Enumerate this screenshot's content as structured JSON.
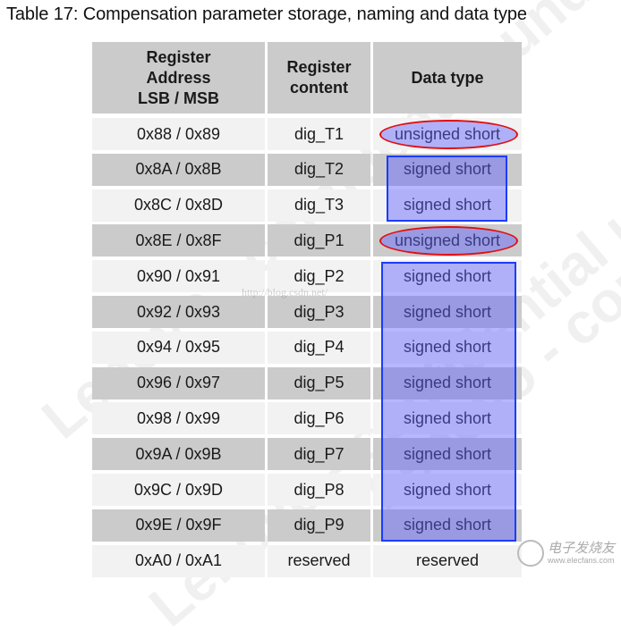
{
  "caption": "Table 17: Compensation parameter storage, naming and data type",
  "table": {
    "headers": [
      "Register\nAddress\nLSB / MSB",
      "Register\ncontent",
      "Data type"
    ],
    "rows": [
      {
        "address": "0x88 / 0x89",
        "content": "dig_T1",
        "type": "unsigned short",
        "highlight": "ellipse"
      },
      {
        "address": "0x8A / 0x8B",
        "content": "dig_T2",
        "type": "signed short",
        "highlight": "box"
      },
      {
        "address": "0x8C / 0x8D",
        "content": "dig_T3",
        "type": "signed short",
        "highlight": "box"
      },
      {
        "address": "0x8E / 0x8F",
        "content": "dig_P1",
        "type": "unsigned short",
        "highlight": "ellipse"
      },
      {
        "address": "0x90 / 0x91",
        "content": "dig_P2",
        "type": "signed short",
        "highlight": "box"
      },
      {
        "address": "0x92 / 0x93",
        "content": "dig_P3",
        "type": "signed short",
        "highlight": "box"
      },
      {
        "address": "0x94 / 0x95",
        "content": "dig_P4",
        "type": "signed short",
        "highlight": "box"
      },
      {
        "address": "0x96 / 0x97",
        "content": "dig_P5",
        "type": "signed short",
        "highlight": "box"
      },
      {
        "address": "0x98 / 0x99",
        "content": "dig_P6",
        "type": "signed short",
        "highlight": "box"
      },
      {
        "address": "0x9A / 0x9B",
        "content": "dig_P7",
        "type": "signed short",
        "highlight": "box"
      },
      {
        "address": "0x9C / 0x9D",
        "content": "dig_P8",
        "type": "signed short",
        "highlight": "box"
      },
      {
        "address": "0x9E / 0x9F",
        "content": "dig_P9",
        "type": "signed short",
        "highlight": "box"
      },
      {
        "address": "0xA0 / 0xA1",
        "content": "reserved",
        "type": "reserved",
        "highlight": "none"
      }
    ]
  },
  "highlight_colors": {
    "ellipse_border": "#e01010",
    "box_border": "#1a3cff",
    "fill": "#6060ff"
  },
  "watermarks": {
    "text": "Lenovo - confidential under NDA",
    "url": "http://blog.csdn.net/"
  },
  "logo": {
    "name": "电子发烧友",
    "url": "www.elecfans.com"
  }
}
